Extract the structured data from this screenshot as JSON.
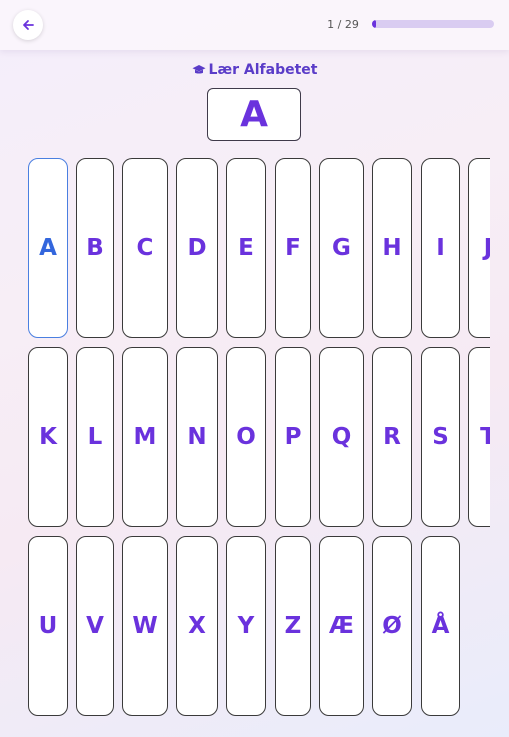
{
  "header": {
    "progress_text": "1 / 29",
    "progress_fraction": 0.035
  },
  "title": "Lær Alfabetet",
  "current_letter": "A",
  "colors": {
    "accent": "#6a32dd",
    "active": "#3366dd"
  },
  "rows": [
    [
      "A",
      "B",
      "C",
      "D",
      "E",
      "F",
      "G",
      "H",
      "I",
      "J"
    ],
    [
      "K",
      "L",
      "M",
      "N",
      "O",
      "P",
      "Q",
      "R",
      "S",
      "T"
    ],
    [
      "U",
      "V",
      "W",
      "X",
      "Y",
      "Z",
      "Æ",
      "Ø",
      "Å"
    ]
  ]
}
